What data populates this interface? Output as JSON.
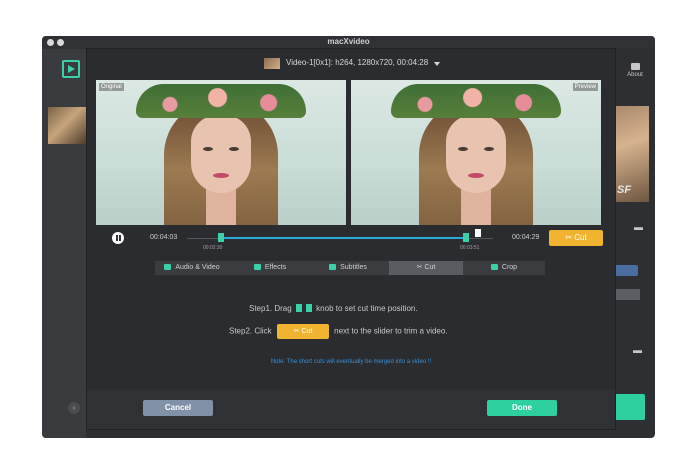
{
  "app": {
    "title": "macXvideo",
    "about_label": "About"
  },
  "file": {
    "info": "Video-1[0x1]: h264, 1280x720, 00:04:28"
  },
  "preview": {
    "left_label": "Original",
    "right_label": "Preview",
    "watermark": "SF"
  },
  "player": {
    "current_time": "00:04:03",
    "cut_start": "00:02:30",
    "cut_end": "00:03:51",
    "end_time": "00:04:29",
    "cut_label": "Cut"
  },
  "tabs": [
    {
      "label": "Audio & Video",
      "icon": "palette-icon"
    },
    {
      "label": "Effects",
      "icon": "magic-wand-icon"
    },
    {
      "label": "Subtitles",
      "icon": "subtitles-icon"
    },
    {
      "label": "Cut",
      "icon": "scissors-icon",
      "active": true
    },
    {
      "label": "Crop",
      "icon": "crop-icon"
    }
  ],
  "instructions": {
    "step1_prefix": "Step1. Drag",
    "step1_suffix": "knob to set cut time position.",
    "step2_prefix": "Step2. Click",
    "step2_button": "Cut",
    "step2_suffix": "next to the slider to trim a video.",
    "note": "Note: The short cuts will eventually be merged into a video !!"
  },
  "buttons": {
    "cancel": "Cancel",
    "done": "Done"
  },
  "colors": {
    "accent_green": "#2ed09f",
    "cut_orange": "#f1b430",
    "cancel_gray": "#8191a8",
    "track_blue": "#2aa8d8"
  }
}
